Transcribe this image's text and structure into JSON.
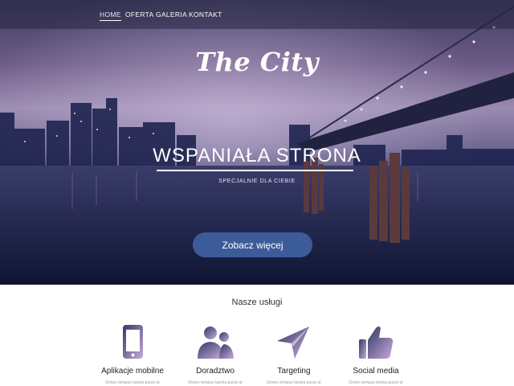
{
  "nav": {
    "items": [
      {
        "label": "HOME",
        "active": true
      },
      {
        "label": "OFERTA",
        "active": false
      },
      {
        "label": "GALERIA",
        "active": false
      },
      {
        "label": "KONTAKT",
        "active": false
      }
    ]
  },
  "hero": {
    "brand": "The City",
    "headline": "WSPANIAŁA STRONA",
    "subheadline": "SPECJALNIE DLA CIEBIE",
    "cta_label": "Zobacz więcej"
  },
  "services": {
    "title": "Nasze usługi",
    "items": [
      {
        "label": "Aplikacje mobilne",
        "icon": "smartphone-icon",
        "desc": "Donec tempus lacinia purus ut"
      },
      {
        "label": "Doradztwo",
        "icon": "users-icon",
        "desc": "Donec tempus lacinia purus ut"
      },
      {
        "label": "Targeting",
        "icon": "paper-plane-icon",
        "desc": "Donec tempus lacinia purus ut"
      },
      {
        "label": "Social media",
        "icon": "thumbs-up-icon",
        "desc": "Donec tempus lacinia purus ut"
      }
    ]
  },
  "colors": {
    "accent": "#3c5c99",
    "icon_gradient_start": "#2e3a66",
    "icon_gradient_end": "#c9a9d8"
  }
}
